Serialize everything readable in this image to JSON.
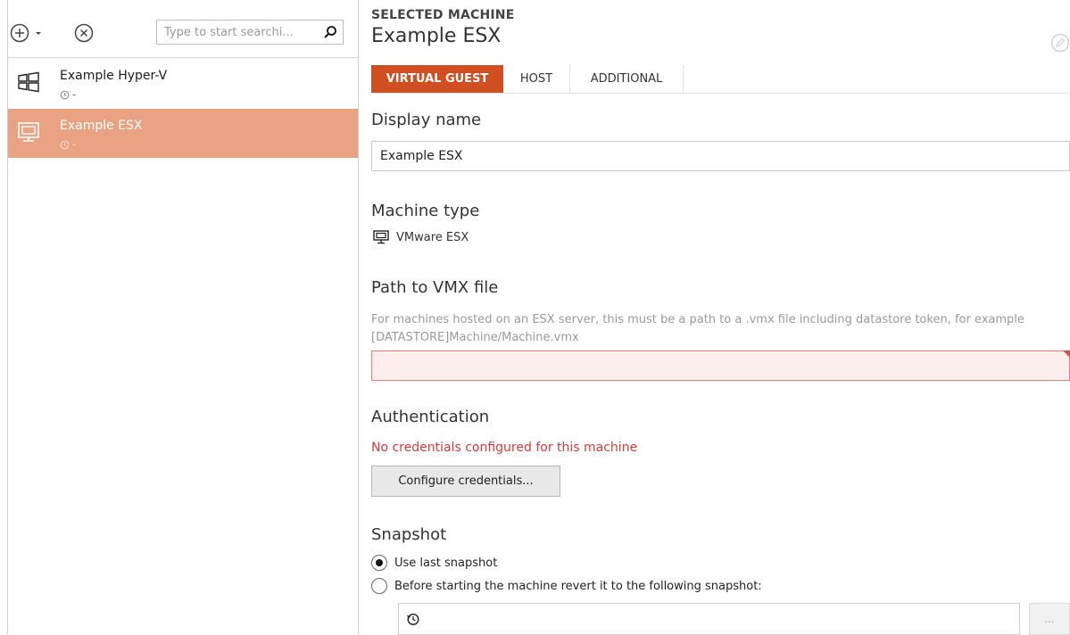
{
  "toolbar": {
    "add_icon": "plus-circle-icon",
    "add_caret_icon": "chevron-down-icon",
    "remove_icon": "close-circle-icon",
    "search": {
      "placeholder": "Type to start searchi...",
      "value": "",
      "icon": "search-icon"
    }
  },
  "machines": [
    {
      "name": "Example Hyper-V",
      "status": "-",
      "icon": "windows-icon",
      "selected": false
    },
    {
      "name": "Example ESX",
      "status": "-",
      "icon": "monitor-icon",
      "selected": true
    }
  ],
  "header": {
    "label": "SELECTED MACHINE",
    "name": "Example ESX",
    "edit_icon": "edit-icon"
  },
  "tabs": [
    {
      "label": "VIRTUAL GUEST",
      "active": true
    },
    {
      "label": "HOST",
      "active": false
    },
    {
      "label": "ADDITIONAL",
      "active": false
    }
  ],
  "form": {
    "display_name": {
      "label": "Display name",
      "value": "Example ESX"
    },
    "machine_type": {
      "label": "Machine type",
      "value": "VMware ESX",
      "icon": "monitor-icon"
    },
    "vmx_path": {
      "label": "Path to VMX file",
      "hint": "For machines hosted on an ESX server, this must be a path to a .vmx file including datastore token, for example [DATASTORE]Machine/Machine.vmx",
      "value": ""
    },
    "authentication": {
      "label": "Authentication",
      "warning": "No credentials configured for this machine",
      "button": "Configure credentials..."
    },
    "snapshot": {
      "label": "Snapshot",
      "options": [
        {
          "label": "Use last snapshot",
          "selected": true
        },
        {
          "label": "Before starting the machine revert it to the following snapshot:",
          "selected": false
        }
      ],
      "field_icon": "history-icon",
      "browse_label": "..."
    }
  },
  "colors": {
    "accent": "#d14e21",
    "selected_row": "#e9a282",
    "error_text": "#d83a3a",
    "error_field": "#fdeeee"
  }
}
